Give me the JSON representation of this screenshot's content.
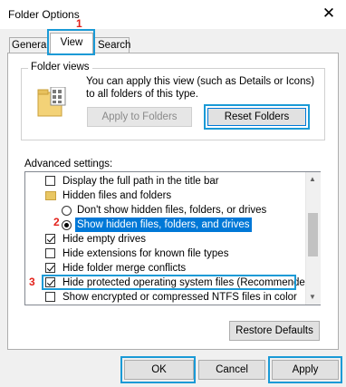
{
  "window": {
    "title": "Folder Options",
    "close_glyph": "✕"
  },
  "tabs": [
    {
      "label": "General"
    },
    {
      "label": "View"
    },
    {
      "label": "Search"
    }
  ],
  "folder_views": {
    "label": "Folder views",
    "description": "You can apply this view (such as Details or Icons) to all folders of this type.",
    "apply_label": "Apply to Folders",
    "reset_label": "Reset Folders"
  },
  "advanced": {
    "label": "Advanced settings:",
    "items": [
      {
        "text": "Display the full path in the title bar",
        "kind": "checkbox",
        "checked": false
      },
      {
        "text": "Hidden files and folders",
        "kind": "folder"
      },
      {
        "text": "Don't show hidden files, folders, or drives",
        "kind": "radio",
        "checked": false
      },
      {
        "text": "Show hidden files, folders, and drives",
        "kind": "radio",
        "checked": true,
        "selected": true
      },
      {
        "text": "Hide empty drives",
        "kind": "checkbox",
        "checked": true
      },
      {
        "text": "Hide extensions for known file types",
        "kind": "checkbox",
        "checked": false
      },
      {
        "text": "Hide folder merge conflicts",
        "kind": "checkbox",
        "checked": true
      },
      {
        "text": "Hide protected operating system files (Recommended)",
        "kind": "checkbox",
        "checked": true
      },
      {
        "text": "Show encrypted or compressed NTFS files in color",
        "kind": "checkbox",
        "checked": false
      }
    ],
    "restore_label": "Restore Defaults"
  },
  "footer": {
    "ok_label": "OK",
    "cancel_label": "Cancel",
    "apply_label": "Apply"
  },
  "annotations": {
    "step1": "1",
    "step2": "2",
    "step3": "3",
    "color": "#e3221b",
    "highlight_color": "#1a9ad6"
  },
  "accent": "#0078d7"
}
